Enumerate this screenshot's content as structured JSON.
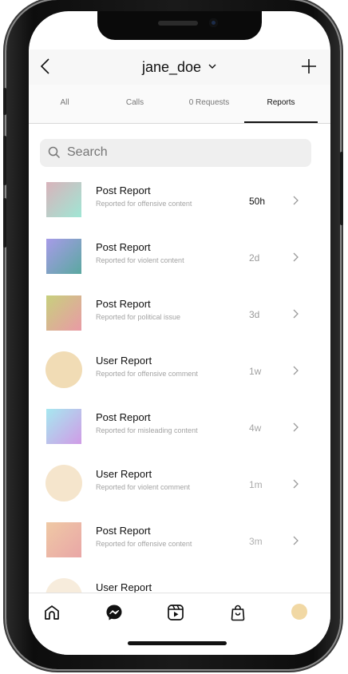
{
  "header": {
    "username": "jane_doe",
    "caret": "⌄"
  },
  "tabs": [
    {
      "label": "All"
    },
    {
      "label": "Calls"
    },
    {
      "label": "0 Requests"
    },
    {
      "label": "Reports",
      "active": true
    }
  ],
  "search": {
    "placeholder": "Search"
  },
  "reports": [
    {
      "title": "Post Report",
      "subtitle": "Reported for offensive content",
      "time": "50h",
      "shape": "square",
      "gradient": [
        "#d9b3bb",
        "#9fe6d4"
      ]
    },
    {
      "title": "Post Report",
      "subtitle": "Reported for violent content",
      "time": "2d",
      "shape": "square",
      "gradient": [
        "#a79be8",
        "#5aa8a0"
      ]
    },
    {
      "title": "Post Report",
      "subtitle": "Reported for political issue",
      "time": "3d",
      "shape": "square",
      "gradient": [
        "#c7d07d",
        "#e99aa5"
      ]
    },
    {
      "title": "User Report",
      "subtitle": "Reported for offensive comment",
      "time": "1w",
      "shape": "circle",
      "gradient": [
        "#f1dcb5",
        "#f1dcb5"
      ]
    },
    {
      "title": "Post Report",
      "subtitle": "Reported for misleading content",
      "time": "4w",
      "shape": "square",
      "gradient": [
        "#a6e8f0",
        "#d09be6"
      ]
    },
    {
      "title": "User Report",
      "subtitle": "Reported for violent comment",
      "time": "1m",
      "shape": "circle",
      "gradient": [
        "#f5e5cc",
        "#f5e5cc"
      ]
    },
    {
      "title": "Post Report",
      "subtitle": "Reported for offensive content",
      "time": "3m",
      "shape": "square",
      "gradient": [
        "#efc9a5",
        "#e9a6a6"
      ]
    },
    {
      "title": "User Report",
      "subtitle": "",
      "time": "",
      "shape": "circle",
      "gradient": [
        "#f7ecdc",
        "#f7ecdc"
      ]
    }
  ],
  "time_colors": [
    "#111111",
    "#9a9a9a",
    "#9a9a9a",
    "#a0a0a0",
    "#a6a6a6",
    "#aaaaaa",
    "#b0b0b0",
    "#b5b5b5"
  ],
  "nav": {
    "items": [
      "home-icon",
      "messenger-icon",
      "reels-icon",
      "shop-icon",
      "profile-avatar"
    ],
    "avatar_color": "#f1d8a4"
  }
}
